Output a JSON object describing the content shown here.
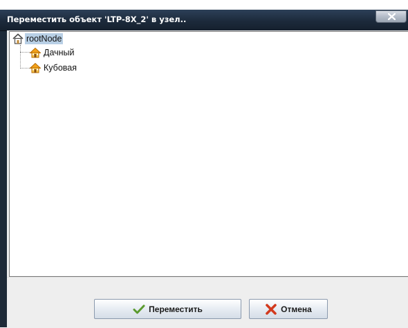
{
  "dialog": {
    "title": "Переместить объект 'LTP-8X_2' в узел..",
    "close_label": "X"
  },
  "tree": {
    "root": {
      "label": "rootNode",
      "icon": "house-icon",
      "selected": true
    },
    "children": [
      {
        "label": "Дачный",
        "icon": "house-node-icon"
      },
      {
        "label": "Кубовая",
        "icon": "house-node-icon"
      }
    ]
  },
  "buttons": {
    "move_label": "Переместить",
    "move_icon": "checkmark-icon",
    "cancel_label": "Отмена",
    "cancel_icon": "red-x-icon"
  },
  "colors": {
    "titlebar": "#1c2a3b",
    "selection": "#b8cfe5",
    "checkmark": "#5a9a2e",
    "cancel_x": "#d23a1e"
  }
}
